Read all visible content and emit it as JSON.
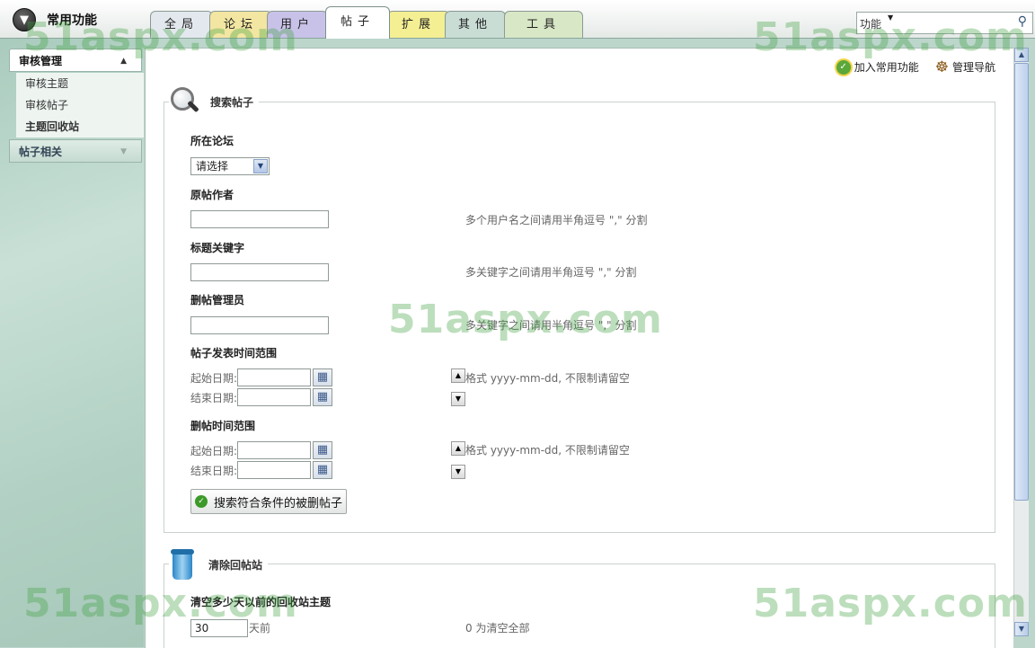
{
  "brand": {
    "title": "常用功能",
    "icon": "down-arrow-circle-icon"
  },
  "tabs": [
    {
      "label": "全局",
      "color": "#e3e8ee"
    },
    {
      "label": "论坛",
      "color": "#f3e6a2"
    },
    {
      "label": "用户",
      "color": "#c8c2e8"
    },
    {
      "label": "帖子",
      "color": "#ffffff",
      "active": true
    },
    {
      "label": "扩展",
      "color": "#f4ef93"
    },
    {
      "label": "其他",
      "color": "#c9ddd5"
    },
    {
      "label": "工具",
      "color": "#d8e7c6"
    }
  ],
  "search": {
    "scope_label": "功能",
    "value": ""
  },
  "sidebar": {
    "group1": {
      "label": "审核管理",
      "items": [
        "审核主题",
        "审核帖子",
        "主题回收站"
      ]
    },
    "group2": {
      "label": "帖子相关"
    }
  },
  "quick_links": {
    "add_favorite": "加入常用功能",
    "nav": "管理导航"
  },
  "search_panel": {
    "title": "搜索帖子",
    "forum_label": "所在论坛",
    "forum_select": "请选择",
    "author_label": "原帖作者",
    "author_hint": "多个用户名之间请用半角逗号 \",\" 分割",
    "keyword_label": "标题关键字",
    "keyword_hint": "多关键字之间请用半角逗号 \",\" 分割",
    "admin_label": "删帖管理员",
    "admin_hint": "多关键字之间请用半角逗号 \",\" 分割",
    "post_time_label": "帖子发表时间范围",
    "start_label": "起始日期:",
    "end_label": "结束日期:",
    "date_hint": "格式 yyyy-mm-dd, 不限制请留空",
    "delete_time_label": "删帖时间范围",
    "submit": "搜索符合条件的被删帖子"
  },
  "clear_panel": {
    "title": "清除回帖站",
    "days_label": "清空多少天以前的回收站主题",
    "days_value": "30",
    "days_suffix": "天前",
    "days_hint": "0 为清空全部"
  },
  "watermark": "51aspx.com"
}
